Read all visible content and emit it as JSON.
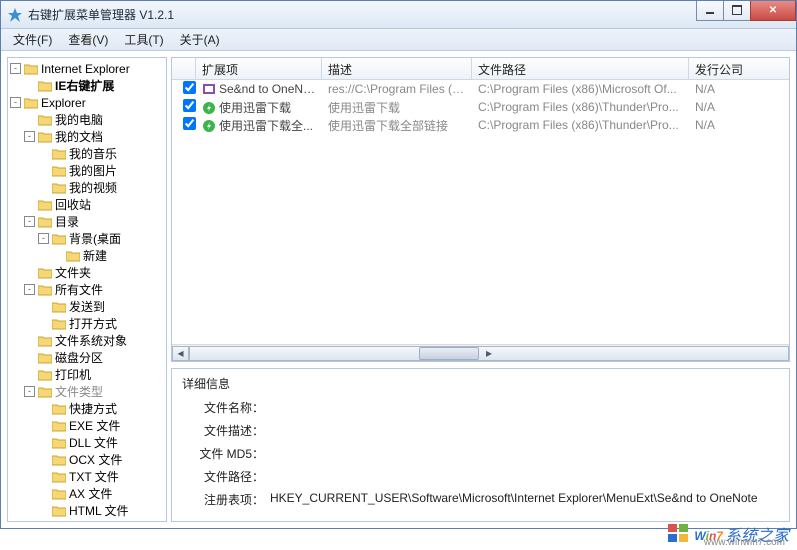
{
  "window": {
    "title": "右键扩展菜单管理器 V1.2.1"
  },
  "menu": [
    "文件(F)",
    "查看(V)",
    "工具(T)",
    "关于(A)"
  ],
  "tree": {
    "ie": "Internet Explorer",
    "ie_ext": "IE右键扩展",
    "explorer": "Explorer",
    "mycomputer": "我的电脑",
    "mydocs": "我的文档",
    "mymusic": "我的音乐",
    "mypics": "我的图片",
    "myvideo": "我的视频",
    "recycle": "回收站",
    "catalog": "目录",
    "background": "背景(桌面",
    "new": "新建",
    "folder": "文件夹",
    "allfiles": "所有文件",
    "sendto": "发送到",
    "openwith": "打开方式",
    "filesysobj": "文件系统对象",
    "diskpart": "磁盘分区",
    "printer": "打印机",
    "filetype": "文件类型",
    "shortcut": "快捷方式",
    "exe": "EXE 文件",
    "dll": "DLL 文件",
    "ocx": "OCX 文件",
    "txt": "TXT 文件",
    "ax": "AX 文件",
    "html": "HTML 文件"
  },
  "columns": {
    "ext": "扩展项",
    "desc": "描述",
    "path": "文件路径",
    "pub": "发行公司"
  },
  "rows": [
    {
      "checked": true,
      "icon": "onenote",
      "ext": "Se&nd to OneNote",
      "desc": "res://C:\\Program Files (x...",
      "path": "C:\\Program Files (x86)\\Microsoft Of...",
      "pub": "N/A"
    },
    {
      "checked": true,
      "icon": "thunder",
      "ext": "使用迅雷下载",
      "desc": "使用迅雷下载",
      "path": "C:\\Program Files (x86)\\Thunder\\Pro...",
      "pub": "N/A"
    },
    {
      "checked": true,
      "icon": "thunder",
      "ext": "使用迅雷下载全...",
      "desc": "使用迅雷下载全部链接",
      "path": "C:\\Program Files (x86)\\Thunder\\Pro...",
      "pub": "N/A"
    }
  ],
  "detail": {
    "title": "详细信息",
    "labels": {
      "name": "文件名称：",
      "desc": "文件描述：",
      "md5": "文件 MD5：",
      "path": "文件路径：",
      "reg": "注册表项："
    },
    "values": {
      "name": "",
      "desc": "",
      "md5": "",
      "path": "",
      "reg": "HKEY_CURRENT_USER\\Software\\Microsoft\\Internet Explorer\\MenuExt\\Se&nd to OneNote"
    }
  },
  "watermark": {
    "brand": "Win7",
    "suffix": "系统之家",
    "url": "www.winwin7.com"
  }
}
